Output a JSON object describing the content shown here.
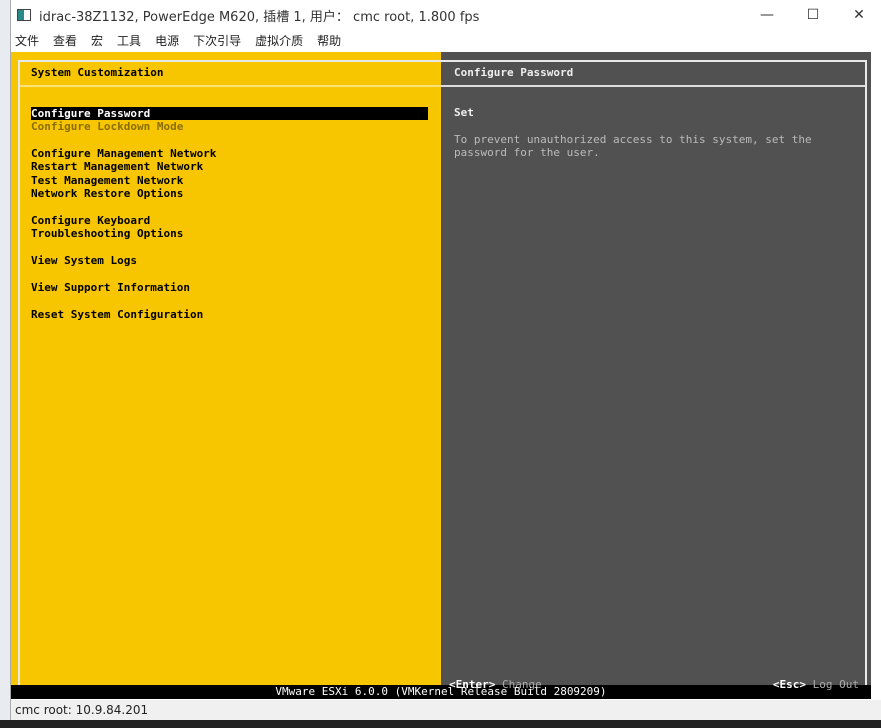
{
  "window": {
    "title": "idrac-38Z1132, PowerEdge M620,  插槽 1, 用户： cmc root, 1.800 fps",
    "minimize": "—",
    "maximize": "☐",
    "close": "✕"
  },
  "menu": [
    "文件",
    "查看",
    "宏",
    "工具",
    "电源",
    "下次引导",
    "虚拟介质",
    "帮助"
  ],
  "left": {
    "header": "System Customization",
    "items": [
      {
        "label": "Configure Password",
        "state": "selected"
      },
      {
        "label": "Configure Lockdown Mode",
        "state": "disabled"
      },
      {
        "label": "Configure Management Network",
        "state": "normal"
      },
      {
        "label": "Restart Management Network",
        "state": "normal"
      },
      {
        "label": "Test Management Network",
        "state": "normal"
      },
      {
        "label": "Network Restore Options",
        "state": "normal"
      },
      {
        "label": "Configure Keyboard",
        "state": "normal"
      },
      {
        "label": "Troubleshooting Options",
        "state": "normal"
      },
      {
        "label": "View System Logs",
        "state": "normal"
      },
      {
        "label": "View Support Information",
        "state": "normal"
      },
      {
        "label": "Reset System Configuration",
        "state": "normal"
      }
    ]
  },
  "right": {
    "header": "Configure Password",
    "status": "Set",
    "description": "To prevent unauthorized access to this system, set the\npassword for the user.",
    "enter_key": "<Enter>",
    "enter_action": "Change",
    "esc_key": "<Esc>",
    "esc_action": "Log Out"
  },
  "footer_bar": "VMware ESXi 6.0.0 (VMKernel Release Build 2809209)",
  "statusbar": "cmc root: 10.9.84.201",
  "colors": {
    "left_bg": "#f7c600",
    "right_bg": "#515151"
  }
}
